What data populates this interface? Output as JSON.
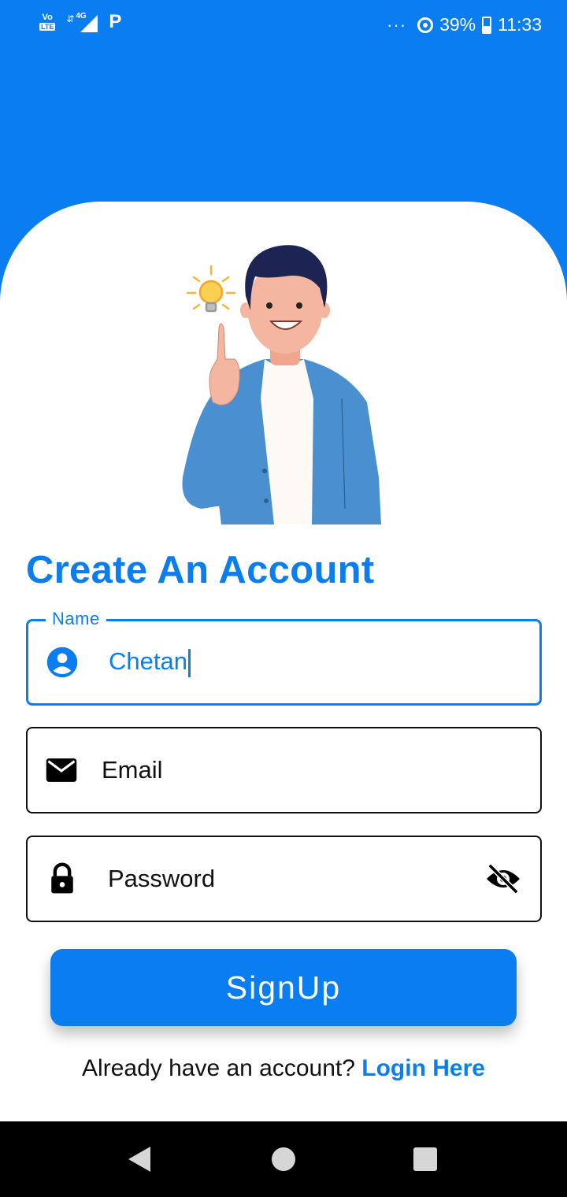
{
  "status_bar": {
    "volte": "Vo",
    "lte": "LTE",
    "network": "4G",
    "app_indicator": "P",
    "overflow": "···",
    "battery": "39%",
    "time": "11:33"
  },
  "title": "Create An Account",
  "fields": {
    "name": {
      "label": "Name",
      "value": "Chetan",
      "icon": "account-circle-icon"
    },
    "email": {
      "placeholder": "Email",
      "icon": "mail-icon"
    },
    "password": {
      "placeholder": "Password",
      "icon": "lock-icon",
      "toggle_icon": "visibility-off-icon"
    }
  },
  "signup_button": "SignUp",
  "footer": {
    "prompt": "Already have an account?",
    "link": "Login Here"
  },
  "colors": {
    "accent": "#0a7df0",
    "text": "#111111",
    "background": "#ffffff",
    "navbar": "#000000"
  }
}
